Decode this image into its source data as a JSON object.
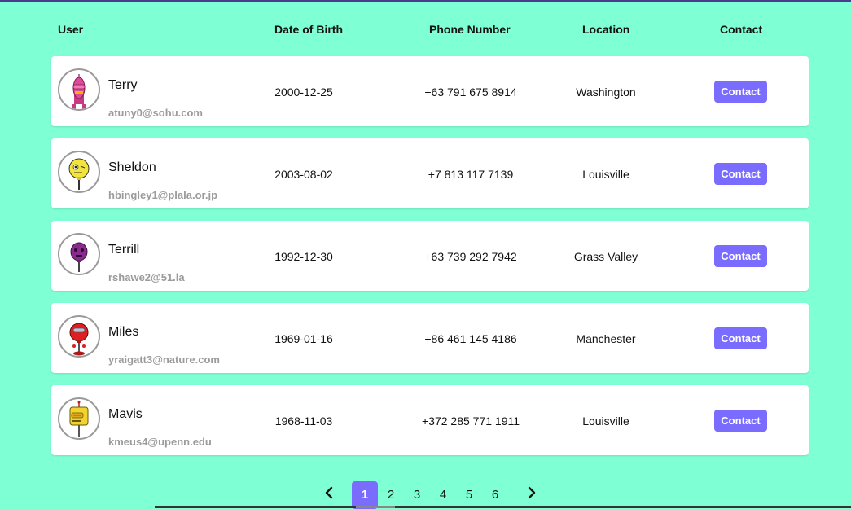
{
  "table": {
    "columns": {
      "user": "User",
      "dob": "Date of Birth",
      "phone": "Phone Number",
      "location": "Location",
      "contact": "Contact"
    },
    "rows": [
      {
        "name": "Terry",
        "email": "atuny0@sohu.com",
        "dob": "2000-12-25",
        "phone": "+63 791 675 8914",
        "location": "Washington",
        "button": "Contact",
        "avatar_color": "#e0489a"
      },
      {
        "name": "Sheldon",
        "email": "hbingley1@plala.or.jp",
        "dob": "2003-08-02",
        "phone": "+7 813 117 7139",
        "location": "Louisville",
        "button": "Contact",
        "avatar_color": "#f2e43a"
      },
      {
        "name": "Terrill",
        "email": "rshawe2@51.la",
        "dob": "1992-12-30",
        "phone": "+63 739 292 7942",
        "location": "Grass Valley",
        "button": "Contact",
        "avatar_color": "#8a2a8f"
      },
      {
        "name": "Miles",
        "email": "yraigatt3@nature.com",
        "dob": "1969-01-16",
        "phone": "+86 461 145 4186",
        "location": "Manchester",
        "button": "Contact",
        "avatar_color": "#e02020"
      },
      {
        "name": "Mavis",
        "email": "kmeus4@upenn.edu",
        "dob": "1968-11-03",
        "phone": "+372 285 771 1911",
        "location": "Louisville",
        "button": "Contact",
        "avatar_color": "#f0d230"
      }
    ]
  },
  "pagination": {
    "prev_icon": "chevron-left-icon",
    "next_icon": "chevron-right-icon",
    "pages": [
      "1",
      "2",
      "3",
      "4",
      "5",
      "6"
    ],
    "current": "1"
  },
  "colors": {
    "background": "#7fffd4",
    "accent": "#7a6cff",
    "email": "#9b9b9b"
  }
}
